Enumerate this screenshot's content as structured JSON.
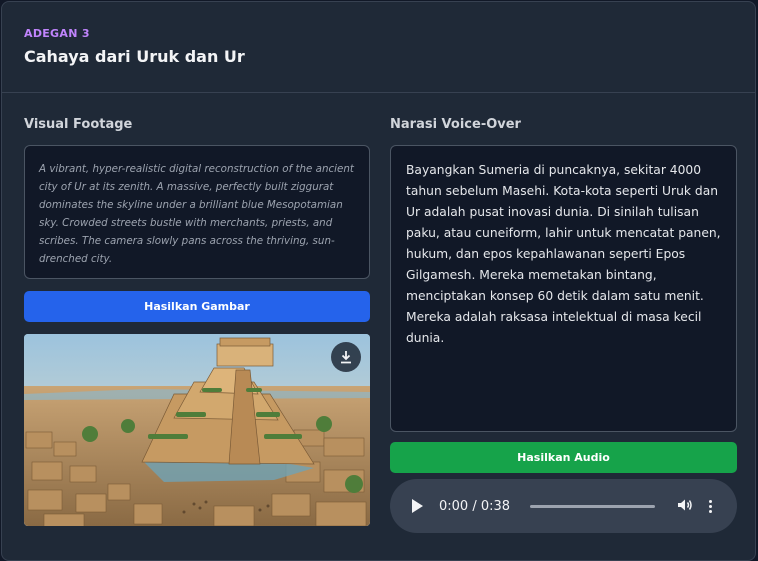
{
  "scene": {
    "label": "ADEGAN 3",
    "title": "Cahaya dari Uruk dan Ur"
  },
  "visual": {
    "label": "Visual Footage",
    "prompt": "A vibrant, hyper-realistic digital reconstruction of the ancient city of Ur at its zenith. A massive, perfectly built ziggurat dominates the skyline under a brilliant blue Mesopotamian sky. Crowded streets bustle with merchants, priests, and scribes. The camera slowly pans across the thriving, sun-drenched city.",
    "generate_button": "Hasilkan Gambar",
    "download_icon": "download-icon"
  },
  "narration": {
    "label": "Narasi Voice-Over",
    "text": "Bayangkan Sumeria di puncaknya, sekitar 4000 tahun sebelum Masehi. Kota-kota seperti Uruk dan Ur adalah pusat inovasi dunia. Di sinilah tulisan paku, atau cuneiform, lahir untuk mencatat panen, hukum, dan epos kepahlawanan seperti Epos Gilgamesh. Mereka memetakan bintang, menciptakan konsep 60 detik dalam satu menit. Mereka adalah raksasa intelektual di masa kecil dunia.",
    "generate_button": "Hasilkan Audio"
  },
  "audio": {
    "time": "0:00 / 0:38",
    "progress": 0
  },
  "colors": {
    "accent_purple": "#c084fc",
    "button_blue": "#2563eb",
    "button_green": "#16a34a",
    "card_bg": "#1f2937"
  }
}
